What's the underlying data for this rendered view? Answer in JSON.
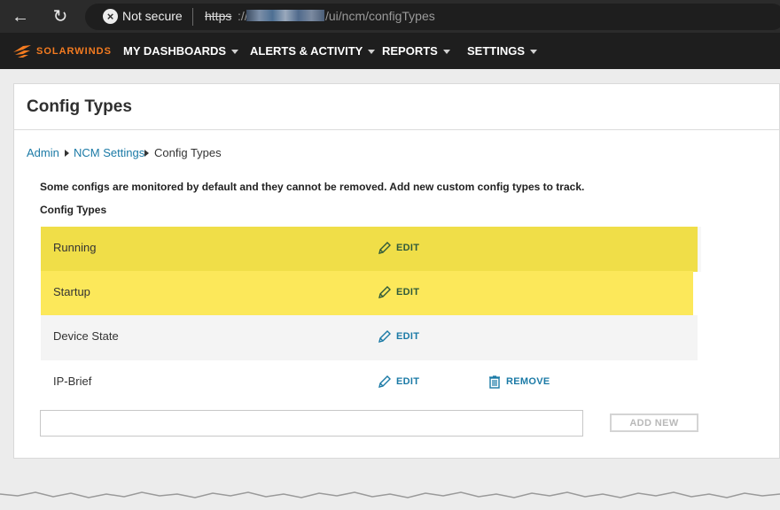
{
  "browser": {
    "security_label": "Not secure",
    "url_scheme": "https",
    "url_sep": "://",
    "url_path": "/ui/ncm/configTypes"
  },
  "app_nav": {
    "logo_text": "SOLARWINDS",
    "brand_color": "#f47b20",
    "items": [
      {
        "label": "MY DASHBOARDS"
      },
      {
        "label": "ALERTS & ACTIVITY"
      },
      {
        "label": "REPORTS"
      },
      {
        "label": "SETTINGS"
      }
    ]
  },
  "page": {
    "title": "Config Types",
    "breadcrumb": [
      {
        "label": "Admin"
      },
      {
        "label": "NCM Settings"
      },
      {
        "label": "Config Types"
      }
    ],
    "intro": "Some configs are monitored by default and they cannot be removed. Add new custom config types to track.",
    "section_label": "Config Types"
  },
  "config_types": [
    {
      "name": "Running",
      "edit_label": "EDIT",
      "highlighted": true
    },
    {
      "name": "Startup",
      "edit_label": "EDIT",
      "highlighted": true
    },
    {
      "name": "Device State",
      "edit_label": "EDIT",
      "highlighted": false
    },
    {
      "name": "IP-Brief",
      "edit_label": "EDIT",
      "remove_label": "REMOVE",
      "highlighted": false
    }
  ],
  "add": {
    "input_value": "",
    "button_label": "ADD NEW"
  },
  "colors": {
    "highlight": "#fce85a",
    "link": "#1b7aa6"
  }
}
